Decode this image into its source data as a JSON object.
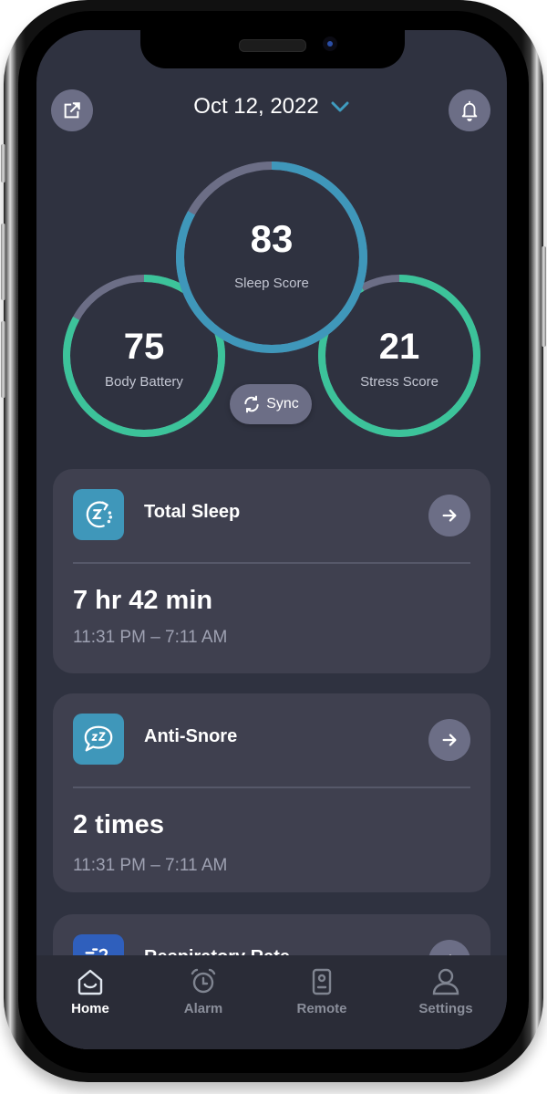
{
  "header": {
    "date": "Oct 12, 2022",
    "share_icon": "share-external-icon",
    "bell_icon": "bell-icon",
    "dropdown_icon": "chevron-down-icon"
  },
  "colors": {
    "background": "#2f3240",
    "card": "#3f404f",
    "button": "#6c6e86",
    "green": "#3cc39a",
    "blue": "#3f97ba",
    "ring_track": "#6c6e86",
    "accent_chevron": "#3f9cc0",
    "respiratory_icon": "#2f5fbc"
  },
  "scores": {
    "sleep": {
      "value": "83",
      "label": "Sleep Score",
      "fill_fraction": 0.83
    },
    "body_battery": {
      "value": "75",
      "label": "Body Battery",
      "fill_fraction": 0.83
    },
    "stress": {
      "value": "21",
      "label": "Stress Score",
      "fill_fraction": 0.92
    }
  },
  "sync": {
    "label": "Sync",
    "icon": "sync-icon"
  },
  "cards": [
    {
      "title": "Total Sleep",
      "icon": "sleep-cycle-icon",
      "value": "7 hr 42 min",
      "time_range": "11:31 PM – 7:11 AM"
    },
    {
      "title": "Anti-Snore",
      "icon": "snore-bubble-icon",
      "value": "2 times",
      "time_range": "11:31 PM – 7:11 AM"
    },
    {
      "title": "Respiratory Rate",
      "icon": "respiratory-icon"
    }
  ],
  "tabbar": {
    "items": [
      {
        "label": "Home",
        "icon": "home-icon",
        "active": true
      },
      {
        "label": "Alarm",
        "icon": "alarm-clock-icon",
        "active": false
      },
      {
        "label": "Remote",
        "icon": "remote-icon",
        "active": false
      },
      {
        "label": "Settings",
        "icon": "user-icon",
        "active": false
      }
    ]
  }
}
